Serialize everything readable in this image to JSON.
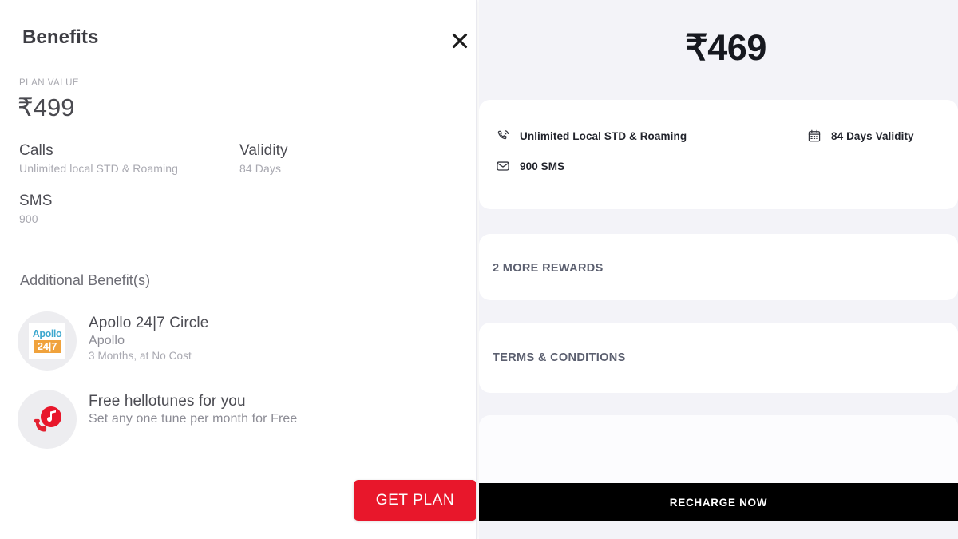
{
  "left_panel": {
    "header_title": "Benefits",
    "close_icon": "close-icon",
    "plan_value_label": "PLAN VALUE",
    "plan_value_amount": "₹499",
    "specs": [
      {
        "title": "Calls",
        "value": "Unlimited local STD & Roaming"
      },
      {
        "title": "Validity",
        "value": "84 Days"
      },
      {
        "title": "SMS",
        "value": "900"
      }
    ],
    "additional_heading": "Additional Benefit(s)",
    "benefits": [
      {
        "icon": "apollo-logo-icon",
        "logo_word": "Apollo",
        "logo_badge": "24|7",
        "title": "Apollo 24|7 Circle",
        "provider": "Apollo",
        "terms": "3 Months, at No Cost"
      },
      {
        "icon": "hellotune-icon",
        "title": "Free hellotunes for you",
        "provider": "Set any one tune per month for Free",
        "terms": ""
      }
    ],
    "get_plan_label": "GET PLAN"
  },
  "right_panel": {
    "price": "₹469",
    "specs": [
      {
        "icon": "phone-icon",
        "label": "Unlimited Local STD & Roaming"
      },
      {
        "icon": "calendar-icon",
        "label": "84 Days Validity"
      },
      {
        "icon": "envelope-icon",
        "label": "900 SMS"
      }
    ],
    "rewards_label": "2 MORE REWARDS",
    "terms_label": "TERMS & CONDITIONS",
    "recharge_label": "RECHARGE NOW"
  },
  "colors": {
    "brand_red": "#e8172b",
    "recharge_black": "#000000",
    "panel_grey": "#f3f3f8",
    "apollo_blue": "#3ea8cf",
    "apollo_orange": "#f0a23c"
  }
}
